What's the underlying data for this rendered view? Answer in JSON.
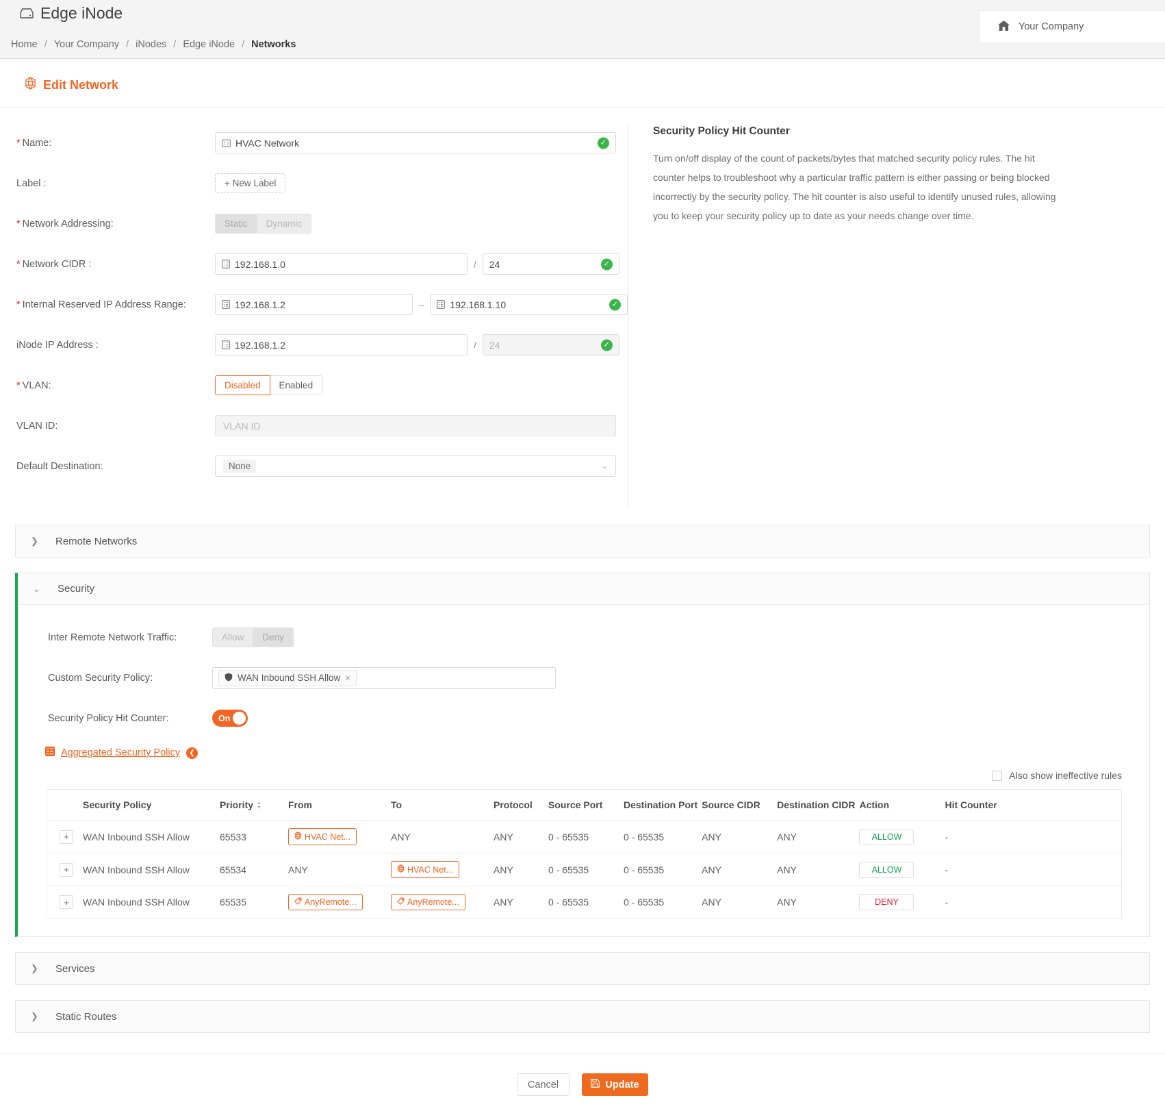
{
  "header": {
    "app_title": "Edge iNode",
    "app_icon": "inode-device-icon",
    "breadcrumb": [
      "Home",
      "Your Company",
      "iNodes",
      "Edge iNode",
      "Networks"
    ],
    "company": {
      "label": "Your Company",
      "icon": "home-icon"
    }
  },
  "page": {
    "title": "Edit Network",
    "title_icon": "network-hex-icon"
  },
  "form": {
    "name": {
      "label": "Name:",
      "required": true,
      "value": "HVAC Network",
      "icon": "name-card-icon",
      "valid": true
    },
    "label_field": {
      "label": "Label :",
      "required": false,
      "button": "+ New Label"
    },
    "network_addressing": {
      "label": "Network Addressing:",
      "required": true,
      "options": [
        "Static",
        "Dynamic"
      ],
      "selected": "Static",
      "disabled": true
    },
    "network_cidr": {
      "label": "Network CIDR :",
      "required": true,
      "address": "192.168.1.0",
      "separator": "/",
      "prefix": "24",
      "icon": "ip-address-icon",
      "valid": true
    },
    "internal_reserved_range": {
      "label": "Internal Reserved IP Address Range:",
      "required": true,
      "from": "192.168.1.2",
      "separator": "–",
      "to": "192.168.1.10",
      "icon": "ip-address-icon",
      "valid": true
    },
    "inode_ip": {
      "label": "iNode IP Address :",
      "required": false,
      "address": "192.168.1.2",
      "separator": "/",
      "prefix": "24",
      "prefix_disabled": true,
      "icon": "ip-address-icon",
      "valid": true
    },
    "vlan": {
      "label": "VLAN:",
      "required": true,
      "options": [
        "Disabled",
        "Enabled"
      ],
      "selected": "Disabled"
    },
    "vlan_id": {
      "label": "VLAN ID:",
      "required": false,
      "placeholder": "VLAN ID",
      "value": "",
      "disabled": true
    },
    "default_destination": {
      "label": "Default Destination:",
      "required": false,
      "selected": "None",
      "caret_icon": "chevron-down-icon"
    }
  },
  "info_panel": {
    "title": "Security Policy Hit Counter",
    "body": "Turn on/off display of the count of packets/bytes that matched security policy rules. The hit counter helps to troubleshoot why a particular traffic pattern is either passing or being blocked incorrectly by the security policy. The hit counter is also useful to identify unused rules, allowing you to keep your security policy up to date as your needs change over time."
  },
  "accordions": {
    "remote_networks": {
      "label": "Remote Networks",
      "expanded": false,
      "chevron": "chevron-right-icon"
    },
    "security": {
      "label": "Security",
      "expanded": true,
      "chevron": "chevron-down-icon"
    },
    "services": {
      "label": "Services",
      "expanded": false,
      "chevron": "chevron-right-icon"
    },
    "static_routes": {
      "label": "Static Routes",
      "expanded": false,
      "chevron": "chevron-right-icon"
    }
  },
  "security": {
    "inter_remote_traffic": {
      "label": "Inter Remote Network Traffic:",
      "options": [
        "Allow",
        "Deny"
      ],
      "selected": "Deny",
      "disabled": true
    },
    "custom_policy": {
      "label": "Custom Security Policy:",
      "chips": [
        {
          "text": "WAN Inbound SSH Allow",
          "icon": "shield-icon",
          "remove": "×"
        }
      ]
    },
    "hit_counter": {
      "label": "Security Policy Hit Counter:",
      "state": "On",
      "on": true
    },
    "aggregated_link": {
      "text": "Aggregated Security Policy",
      "icon": "list-table-icon",
      "badge_icon": "chevron-down-circle-icon"
    },
    "ineffective_checkbox": {
      "label": "Also show ineffective rules",
      "checked": false
    },
    "table": {
      "columns": [
        "",
        "Security Policy",
        "Priority",
        "From",
        "To",
        "Protocol",
        "Source Port",
        "Destination Port",
        "Source CIDR",
        "Destination CIDR",
        "Action",
        "Hit Counter"
      ],
      "sortable_column": "Priority",
      "rows": [
        {
          "expand": "+",
          "policy": "WAN Inbound SSH Allow",
          "priority": "65533",
          "from": {
            "type": "pill",
            "text": "HVAC Net...",
            "icon": "network-hex-icon"
          },
          "to": {
            "type": "text",
            "text": "ANY"
          },
          "protocol": "ANY",
          "source_port": "0 - 65535",
          "destination_port": "0 - 65535",
          "source_cidr": "ANY",
          "destination_cidr": "ANY",
          "action": "ALLOW",
          "hit_counter": "-"
        },
        {
          "expand": "+",
          "policy": "WAN Inbound SSH Allow",
          "priority": "65534",
          "from": {
            "type": "text",
            "text": "ANY"
          },
          "to": {
            "type": "pill",
            "text": "HVAC Net...",
            "icon": "network-hex-icon"
          },
          "protocol": "ANY",
          "source_port": "0 - 65535",
          "destination_port": "0 - 65535",
          "source_cidr": "ANY",
          "destination_cidr": "ANY",
          "action": "ALLOW",
          "hit_counter": "-"
        },
        {
          "expand": "+",
          "policy": "WAN Inbound SSH Allow",
          "priority": "65535",
          "from": {
            "type": "pill",
            "text": "AnyRemote...",
            "icon": "tag-icon"
          },
          "to": {
            "type": "pill",
            "text": "AnyRemote...",
            "icon": "tag-icon"
          },
          "protocol": "ANY",
          "source_port": "0 - 65535",
          "destination_port": "0 - 65535",
          "source_cidr": "ANY",
          "destination_cidr": "ANY",
          "action": "DENY",
          "hit_counter": "-"
        }
      ]
    }
  },
  "footer": {
    "cancel": "Cancel",
    "update": "Update",
    "update_icon": "save-icon"
  },
  "colors": {
    "accent": "#f26522",
    "update_button": "#ee6a1e",
    "allow": "#12a150",
    "deny": "#e8202a",
    "valid": "#3bb54a",
    "security_bar": "#17a84a"
  }
}
